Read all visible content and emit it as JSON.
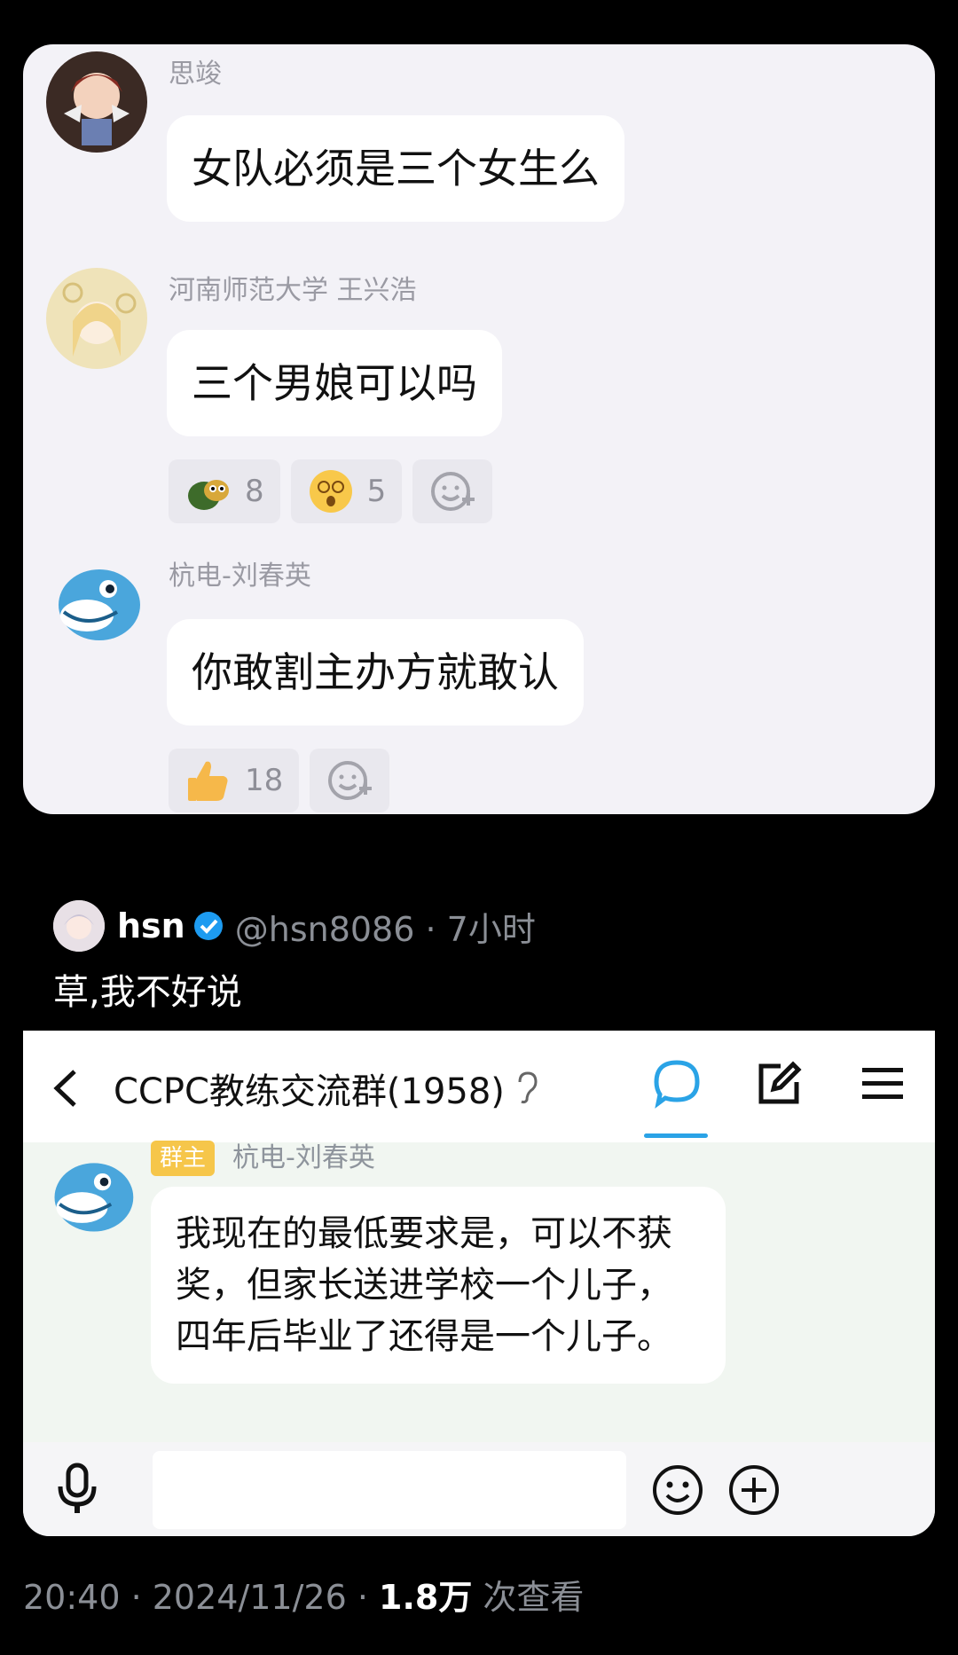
{
  "chat": {
    "messages": [
      {
        "sender": "思竣",
        "text": "女队必须是三个女生么"
      },
      {
        "sender": "河南师范大学 王兴浩",
        "text": "三个男娘可以吗",
        "reactions": [
          {
            "icon": "turtle-emoji",
            "count": "8"
          },
          {
            "icon": "dizzy-face-emoji",
            "count": "5"
          }
        ]
      },
      {
        "sender": "杭电-刘春英",
        "text": "你敢割主办方就敢认",
        "reactions": [
          {
            "icon": "thumbs-up-emoji",
            "count": "18"
          }
        ]
      }
    ]
  },
  "tweet": {
    "name": "hsn",
    "handle": "@hsn8086 · 7小时",
    "text": "草,我不好说"
  },
  "qq": {
    "title": "CCPC教练交流群(1958)",
    "badge": "群主",
    "sender": "杭电-刘春英",
    "message": "我现在的最低要求是，可以不获奖，但家长送进学校一个儿子，四年后毕业了还得是一个儿子。"
  },
  "footer": {
    "time": "20:40 · 2024/11/26 · ",
    "views": "1.8万",
    "views_suffix": " 次查看"
  },
  "colors": {
    "accent": "#2aa3e6",
    "badge": "#f6c64a",
    "verified": "#1d9bf0"
  }
}
